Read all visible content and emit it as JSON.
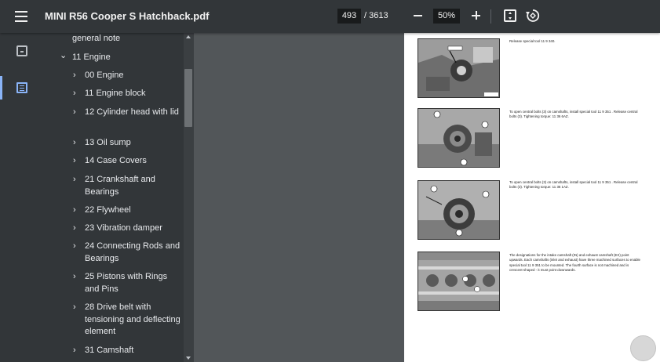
{
  "toolbar": {
    "title": "MINI R56 Cooper S Hatchback.pdf",
    "page_current": "493",
    "page_total": "/ 3613",
    "zoom": "50%"
  },
  "sidebar": {
    "items": [
      {
        "label": "general note",
        "chevron": ""
      },
      {
        "label": "11 Engine",
        "chevron": "⌄"
      },
      {
        "label": "00 Engine",
        "chevron": "›"
      },
      {
        "label": "11 Engine block",
        "chevron": "›"
      },
      {
        "label": "12 Cylinder head with lid",
        "chevron": "›"
      },
      {
        "label": "13 Oil sump",
        "chevron": "›"
      },
      {
        "label": "14 Case Covers",
        "chevron": "›"
      },
      {
        "label": "21 Crankshaft and Bearings",
        "chevron": "›"
      },
      {
        "label": "22 Flywheel",
        "chevron": "›"
      },
      {
        "label": "23 Vibration damper",
        "chevron": "›"
      },
      {
        "label": "24 Connecting Rods and Bearings",
        "chevron": "›"
      },
      {
        "label": "25 Pistons with Rings and Pins",
        "chevron": "›"
      },
      {
        "label": "28 Drive belt with tensioning and deflecting element",
        "chevron": "›"
      },
      {
        "label": "31 Camshaft",
        "chevron": "›"
      }
    ]
  },
  "document": {
    "sections": [
      {
        "text": "Release special tool 11 9 340."
      },
      {
        "text": "To open central bolts (3) on camshafts, install special tool 11 9 351 . Release central bolts (3). Tightening torque: 11 36 6AZ."
      },
      {
        "text": "To open central bolts (3) on camshafts, install special tool 11 9 351 . Release central bolts (3). Tightening torque: 11 36 1AZ."
      },
      {
        "text": "The designations for the intake camshaft (IN) and exhaust camshaft (EX) point upwards. Each camshafts (inlet and exhaust) have three machined surfaces to enable special tool 11 9 351 to be mounted. The fourth surface is not machined and is crescent-shaped - it must point downwards."
      }
    ]
  }
}
